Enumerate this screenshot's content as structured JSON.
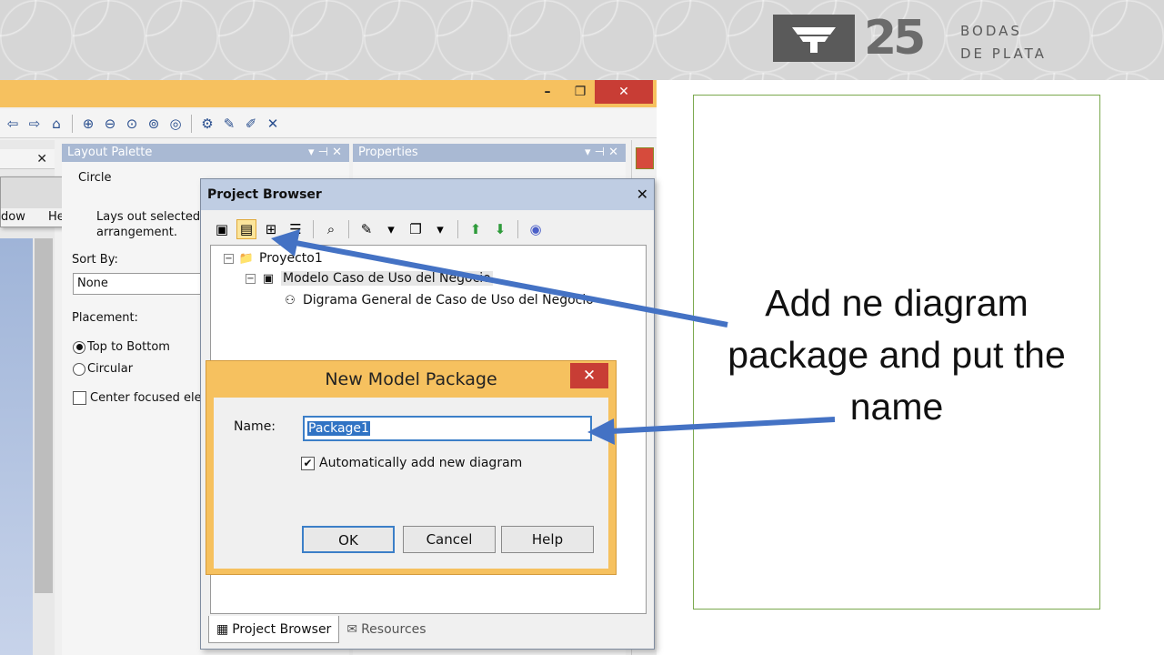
{
  "logo": {
    "year": "25",
    "line1": "BODAS",
    "line2": "DE PLATA"
  },
  "app": {
    "window_buttons": {
      "minimize": "–",
      "maximize": "❐",
      "close": "✕"
    },
    "left_panel": {
      "close": "✕",
      "menu_items": [
        "dow",
        "Help"
      ]
    }
  },
  "layout_palette": {
    "title": "Layout Palette",
    "header_controls": "▾ ⊣ ✕",
    "layout_name": "Circle",
    "description": "Lays out selected arrangement.",
    "sort_by_label": "Sort By:",
    "sort_by_value": "None",
    "placement_label": "Placement:",
    "placement_options": [
      "Top to Bottom",
      "Circular"
    ],
    "placement_selected": "Top to Bottom",
    "center_focused_label": "Center focused ele"
  },
  "properties": {
    "title": "Properties",
    "header_controls": "▾ ⊣ ✕"
  },
  "project_browser": {
    "title": "Project Browser",
    "close": "✕",
    "tree": {
      "root": "Proyecto1",
      "package": "Modelo Caso de Uso del Negocio",
      "diagram": "Digrama General de Caso de Uso del Negocio"
    },
    "tabs": [
      "Project Browser",
      "Resources"
    ]
  },
  "dialog": {
    "title": "New Model Package",
    "close": "✕",
    "name_label": "Name:",
    "name_value": "Package1",
    "auto_add_label": "Automatically add new diagram",
    "auto_add_checked": true,
    "buttons": {
      "ok": "OK",
      "cancel": "Cancel",
      "help": "Help"
    }
  },
  "caption": {
    "text": "Add ne diagram package and put the name"
  },
  "colors": {
    "dialog_accent": "#f6c15f",
    "close_red": "#c83d35",
    "arrow_blue": "#4472c4",
    "textbox_border": "#7aa84d",
    "panel_header": "#a9b9d3"
  }
}
